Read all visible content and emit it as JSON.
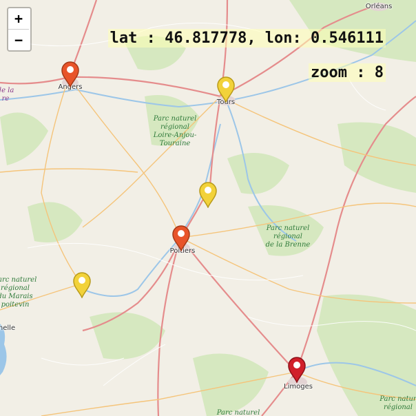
{
  "controls": {
    "zoom_in": "+",
    "zoom_out": "−"
  },
  "overlay": {
    "coordinates": "lat : 46.817778, lon: 0.546111",
    "zoom": "zoom : 8"
  },
  "map": {
    "land_color": "#f2efe6",
    "forest_color": "#d4e6bd",
    "park_color": "#cfe8c6",
    "water_color": "#9cc6e8",
    "motorway_color": "#e8a0a0",
    "road_color": "#f5c47a"
  },
  "cities": {
    "orleans": "Orléans",
    "angers": "Angers",
    "tours": "Tours",
    "poitiers": "Poitiers",
    "limoges": "Limoges",
    "rochelle": "nelle"
  },
  "parks": {
    "loire_anjou": "Parc naturel\nrégional\nLoire-Anjou-\nTouraine",
    "brenne": "Parc naturel\nrégional\nde la Brenne",
    "marais": "Parc naturel\nrégional\ndu Marais\npoitevin",
    "bottom_center": "Parc naturel",
    "bottom_right": "Parc natur\nrégional",
    "left_edge": "de la\nre"
  },
  "markers": [
    {
      "name": "marker-angers",
      "color": "#e8542a",
      "stroke": "#a33a18"
    },
    {
      "name": "marker-tours",
      "color": "#f2d23a",
      "stroke": "#b89a1a"
    },
    {
      "name": "marker-chatellerault",
      "color": "#f2d23a",
      "stroke": "#b89a1a"
    },
    {
      "name": "marker-poitiers",
      "color": "#e8542a",
      "stroke": "#a33a18"
    },
    {
      "name": "marker-niort",
      "color": "#f2d23a",
      "stroke": "#b89a1a"
    },
    {
      "name": "marker-limoges",
      "color": "#d11f2a",
      "stroke": "#8a1018"
    }
  ]
}
